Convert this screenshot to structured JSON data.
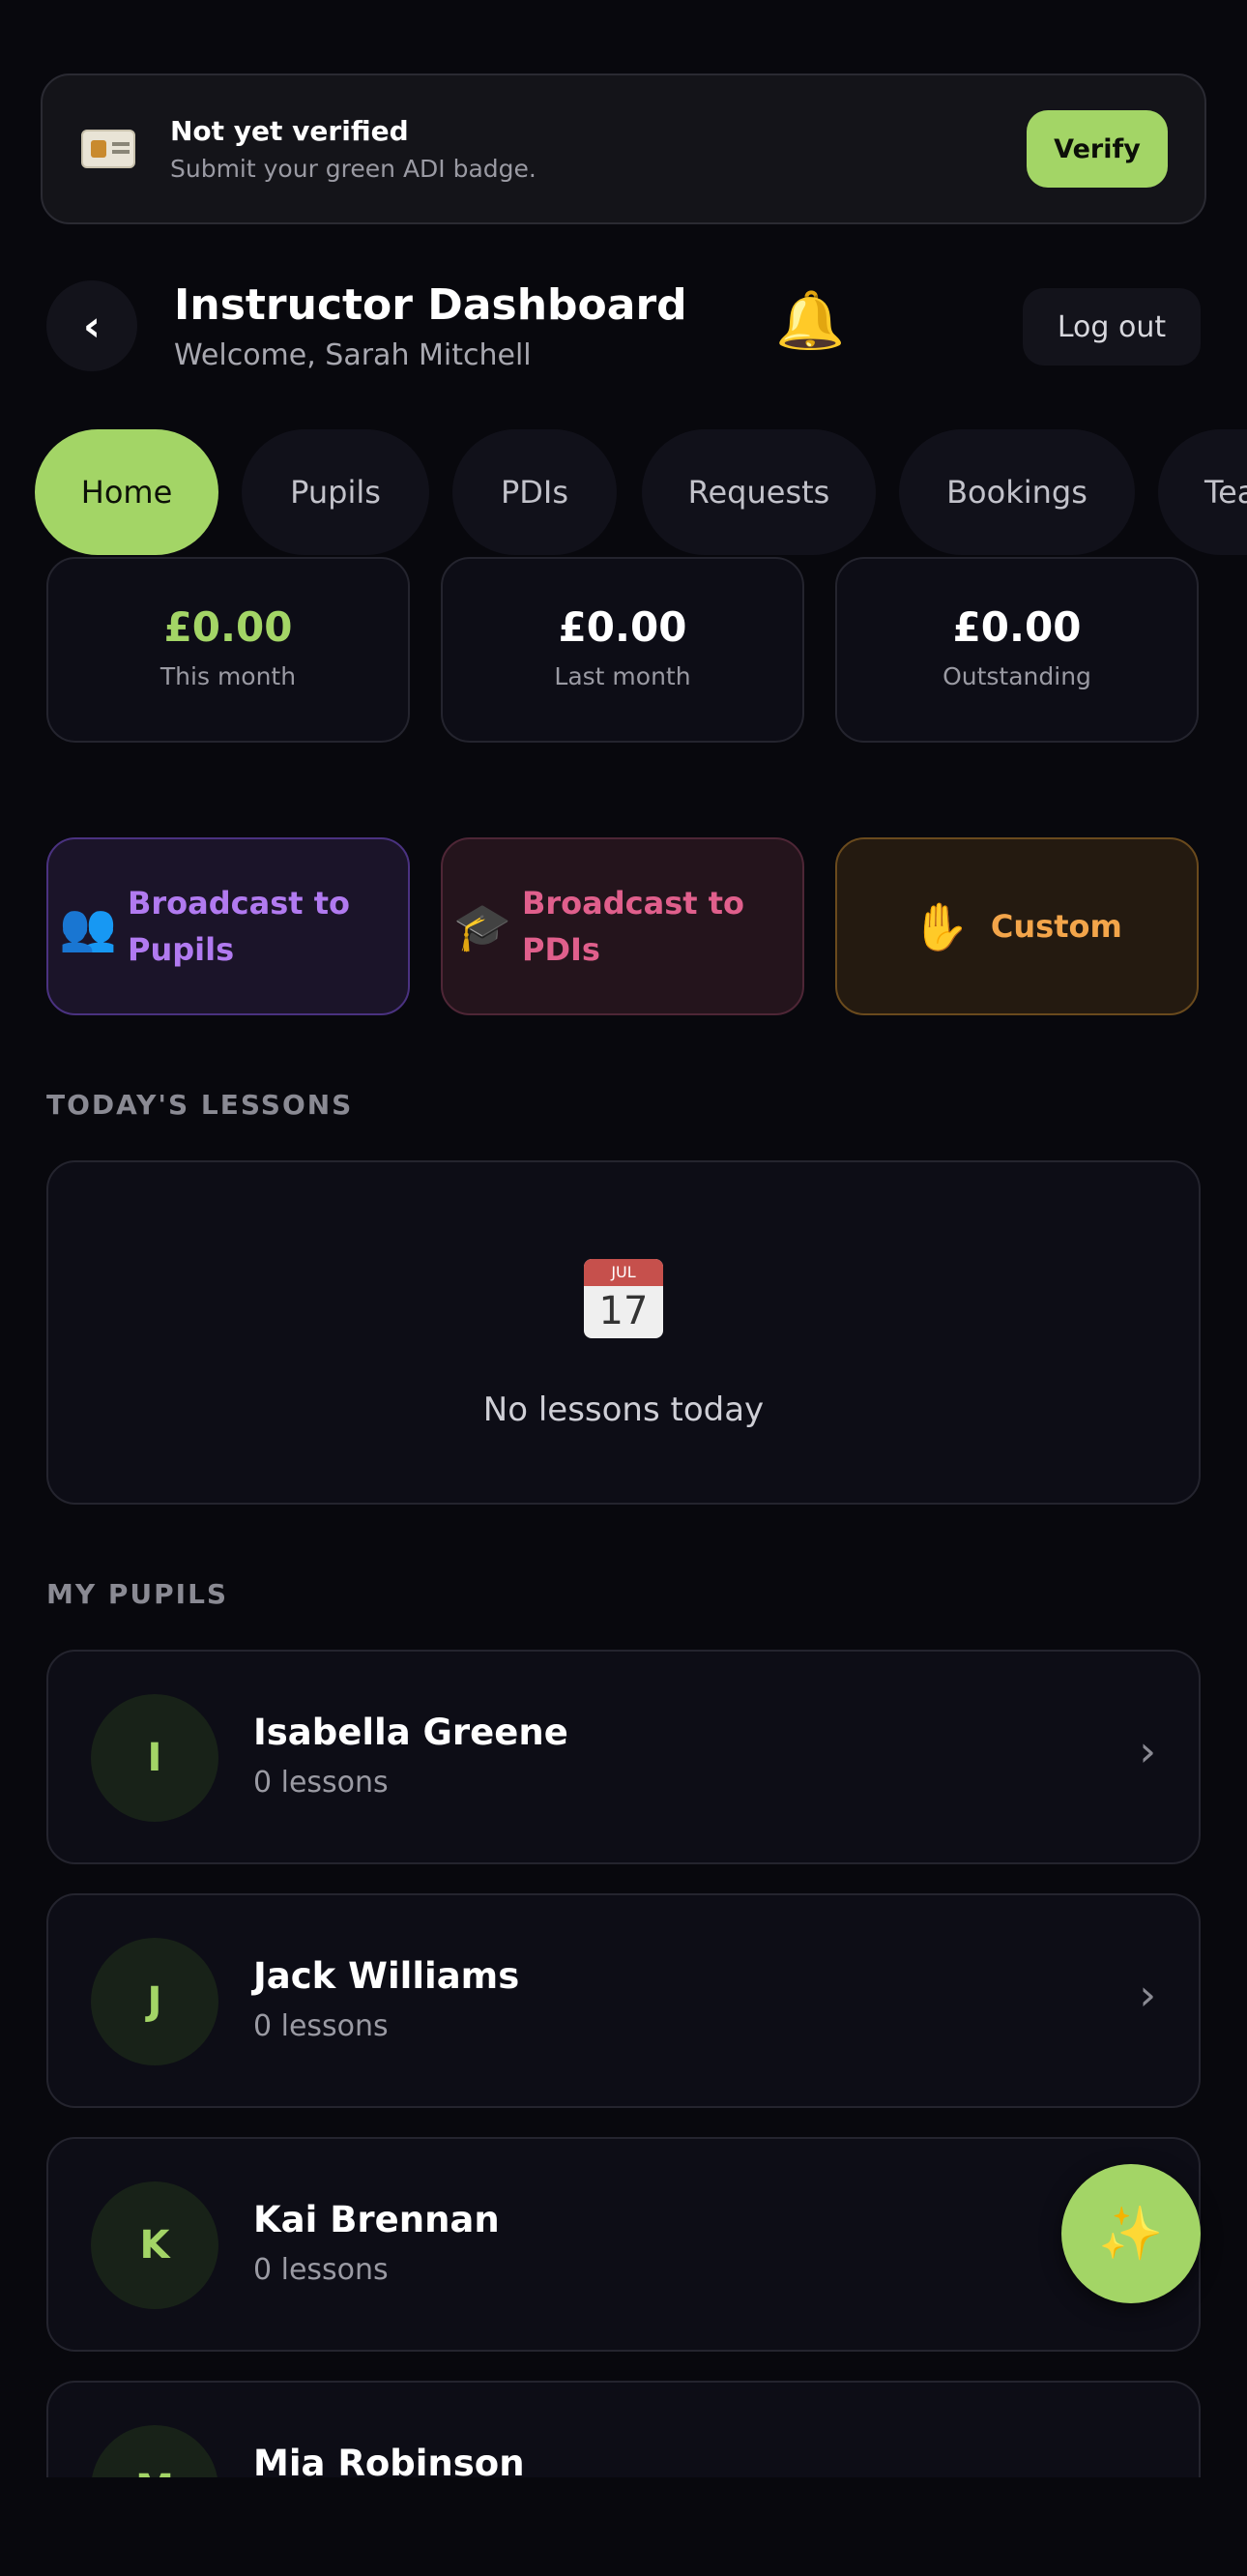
{
  "banner": {
    "icon": "id-badge-icon",
    "title": "Not yet verified",
    "subtitle": "Submit your green ADI badge.",
    "verify_label": "Verify"
  },
  "header": {
    "back_icon": "‹",
    "title": "Instructor Dashboard",
    "subtitle": "Welcome, Sarah Mitchell",
    "bell_icon": "🔔",
    "logout_label": "Log out"
  },
  "tabs": [
    {
      "label": "Home",
      "active": true
    },
    {
      "label": "Pupils"
    },
    {
      "label": "PDIs"
    },
    {
      "label": "Requests"
    },
    {
      "label": "Bookings"
    },
    {
      "label": "Tea"
    }
  ],
  "stats": [
    {
      "value": "£0.00",
      "label": "This month"
    },
    {
      "value": "£0.00",
      "label": "Last month"
    },
    {
      "value": "£0.00",
      "label": "Outstanding"
    }
  ],
  "actions": [
    {
      "icon": "👥",
      "label_line1": "Broadcast to",
      "label_line2": "Pupils"
    },
    {
      "icon": "🎓",
      "label_line1": "Broadcast to",
      "label_line2": "PDIs"
    },
    {
      "icon": "✋",
      "label": "Custom"
    }
  ],
  "todays_lessons": {
    "heading": "TODAY'S LESSONS",
    "calendar_month": "JUL",
    "calendar_day": "17",
    "empty_text": "No lessons today"
  },
  "pupils": {
    "heading": "MY PUPILS",
    "chevron": "›",
    "items": [
      {
        "initial": "I",
        "name": "Isabella Greene",
        "lessons": "0 lessons"
      },
      {
        "initial": "J",
        "name": "Jack Williams",
        "lessons": "0 lessons"
      },
      {
        "initial": "K",
        "name": "Kai Brennan",
        "lessons": "0 lessons"
      },
      {
        "initial": "M",
        "name": "Mia Robinson"
      }
    ]
  },
  "fab_icon": "✨",
  "colors": {
    "background": "#08080d",
    "accent": "#a3d566",
    "purple": "#b17af0",
    "pink": "#e05f8c",
    "orange": "#f3a54a"
  }
}
